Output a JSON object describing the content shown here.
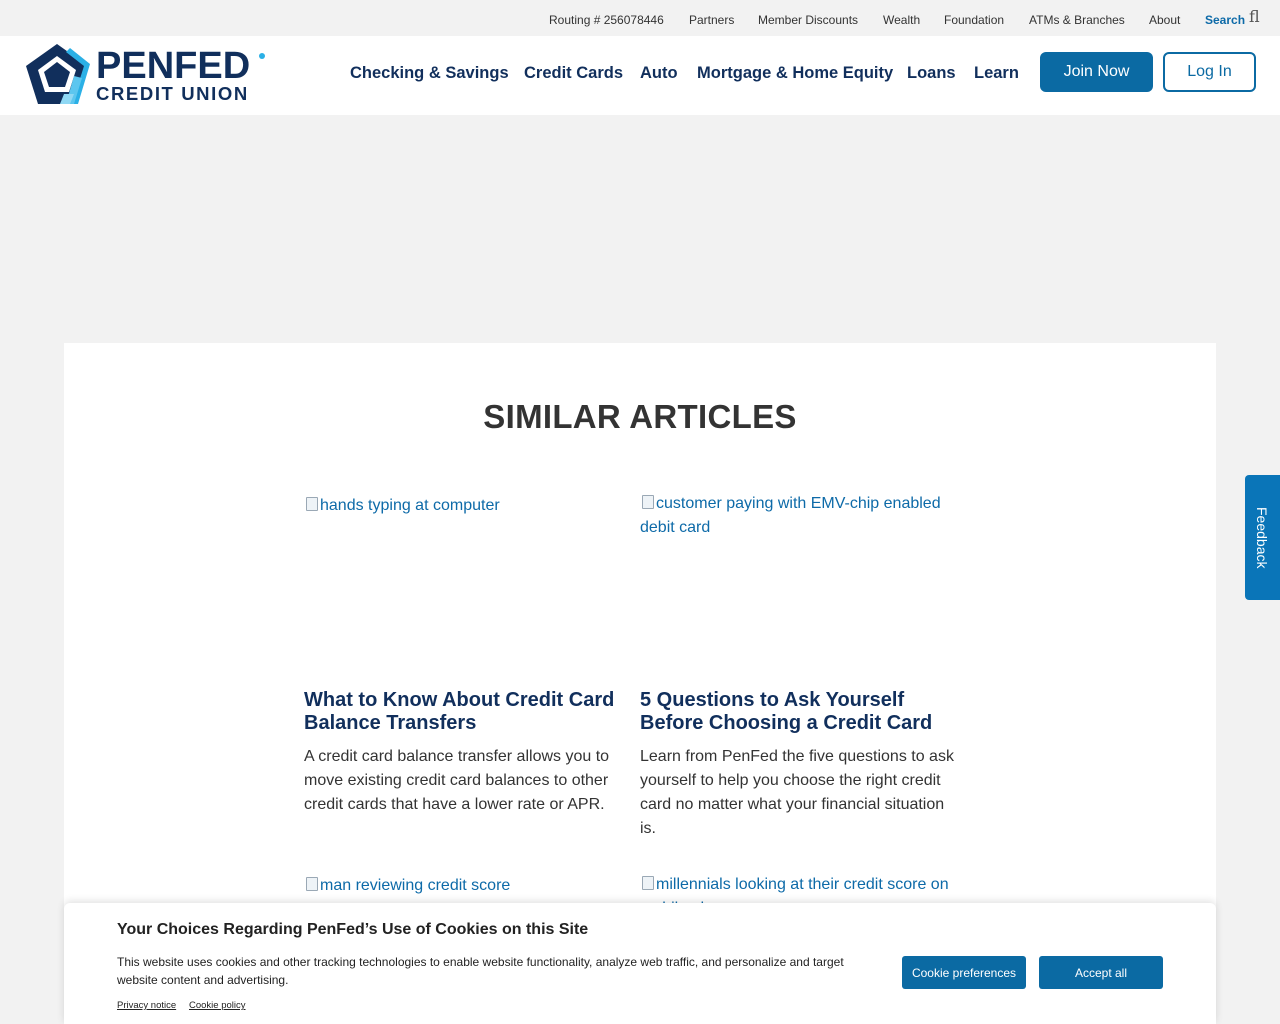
{
  "utility_bar": {
    "routing": "Routing # 256078446",
    "partners": "Partners",
    "member_discounts": "Member Discounts",
    "wealth": "Wealth",
    "foundation": "Foundation",
    "atms_branches": "ATMs & Branches",
    "about": "About",
    "search": "Search",
    "search_icon": "fl"
  },
  "header": {
    "logo_word1": "PENFED",
    "logo_word2": "CREDIT UNION",
    "nav": [
      "Checking & Savings",
      "Credit Cards",
      "Auto",
      "Mortgage & Home Equity",
      "Loans",
      "Learn"
    ],
    "join_label": "Join Now",
    "login_label": "Log In"
  },
  "similar": {
    "title": "SIMILAR ARTICLES",
    "articles": [
      {
        "image_alt": "hands typing at computer",
        "title": "What to Know About Credit Card Balance Transfers",
        "description": "A credit card balance transfer allows you to move existing credit card balances to other credit cards that have a lower rate or APR."
      },
      {
        "image_alt": "customer paying with EMV-chip enabled debit card",
        "title": "5 Questions to Ask Yourself Before Choosing a Credit Card",
        "description": "Learn from PenFed the five questions to ask yourself to help you choose the right credit card no matter what your financial situation is."
      },
      {
        "image_alt": "man reviewing credit score"
      },
      {
        "image_alt": "millennials looking at their credit score on mobile phone"
      }
    ]
  },
  "feedback_label": "Feedback",
  "cookie_banner": {
    "title": "Your Choices Regarding PenFed’s Use of Cookies on this Site",
    "text": "This website uses cookies and other tracking technologies to enable website functionality, analyze web traffic, and personalize and target website content and advertising.",
    "privacy_link": "Privacy notice",
    "policy_link": "Cookie policy",
    "preferences_label": "Cookie preferences",
    "accept_label": "Accept all"
  },
  "colors": {
    "brand_navy": "#112f5c",
    "brand_blue": "#0b6aa3",
    "link_blue": "#0d6aa8",
    "feedback_blue": "#0a75b8",
    "logo_light_blue": "#2bb0e6"
  }
}
